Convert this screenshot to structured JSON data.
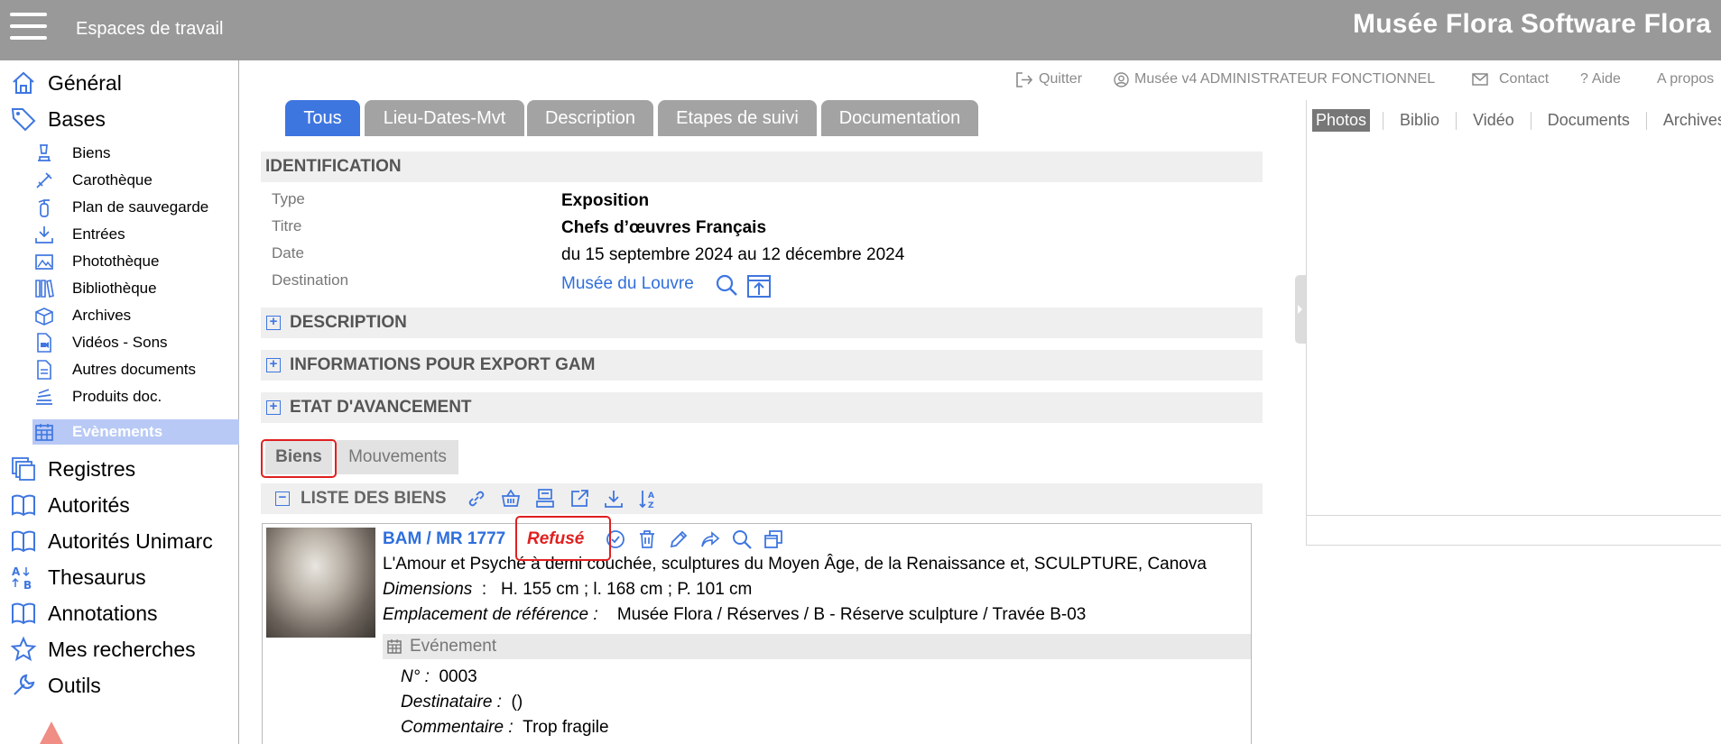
{
  "topbar": {
    "workspaces": "Espaces de travail",
    "app_title": "Musée Flora Software Flora"
  },
  "sidebar": {
    "top_items": [
      {
        "label": "Général",
        "icon": "home-icon"
      },
      {
        "label": "Bases",
        "icon": "tag-icon"
      }
    ],
    "sub_items": [
      {
        "label": "Biens",
        "icon": "object-icon"
      },
      {
        "label": "Carothèque",
        "icon": "pen-icon"
      },
      {
        "label": "Plan de sauvegarde",
        "icon": "extinguisher-icon"
      },
      {
        "label": "Entrées",
        "icon": "download-tray-icon"
      },
      {
        "label": "Photothèque",
        "icon": "image-icon"
      },
      {
        "label": "Bibliothèque",
        "icon": "books-icon"
      },
      {
        "label": "Archives",
        "icon": "box-icon"
      },
      {
        "label": "Vidéos - Sons",
        "icon": "video-file-icon"
      },
      {
        "label": "Autres documents",
        "icon": "document-icon"
      },
      {
        "label": "Produits doc.",
        "icon": "stack-icon"
      },
      {
        "label": "Evènements",
        "icon": "calendar-icon"
      }
    ],
    "bottom_items": [
      {
        "label": "Registres",
        "icon": "registers-icon"
      },
      {
        "label": "Autorités",
        "icon": "book-icon"
      },
      {
        "label": "Autorités Unimarc",
        "icon": "book-icon"
      },
      {
        "label": "Thesaurus",
        "icon": "az-icon"
      },
      {
        "label": "Annotations",
        "icon": "book-icon"
      },
      {
        "label": "Mes recherches",
        "icon": "star-icon"
      },
      {
        "label": "Outils",
        "icon": "wrench-icon"
      }
    ]
  },
  "header_links": {
    "quit": "Quitter",
    "user": "Musée v4 ADMINISTRATEUR FONCTIONNEL",
    "contact": "Contact",
    "help": "Aide",
    "about": "A propos"
  },
  "tabs": [
    "Tous",
    "Lieu-Dates-Mvt",
    "Description",
    "Etapes de suivi",
    "Documentation"
  ],
  "identification": {
    "title": "IDENTIFICATION",
    "fields": [
      {
        "label": "Type",
        "value": "Exposition"
      },
      {
        "label": "Titre",
        "value": "Chefs d’œuvres Français"
      },
      {
        "label": "Date",
        "value": "du 15 septembre 2024 au 12 décembre 2024"
      },
      {
        "label": "Destination",
        "value": "Musée du Louvre"
      }
    ]
  },
  "sections": {
    "description": "DESCRIPTION",
    "export": "INFORMATIONS POUR EXPORT GAM",
    "progress": "ETAT D'AVANCEMENT"
  },
  "subtabs": [
    "Biens",
    "Mouvements"
  ],
  "list": {
    "title": "LISTE DES BIENS",
    "item": {
      "ref": "BAM / MR 1777",
      "status": "Refusé",
      "description": "L'Amour et Psyché à demi couchée, sculptures du Moyen Âge, de la Renaissance et, SCULPTURE, Canova",
      "dimensions_label": "Dimensions",
      "dimensions_value": "H. 155 cm ; l. 168 cm ; P. 101 cm",
      "location_label": "Emplacement de référence :",
      "location_value": "Musée Flora / Réserves / B - Réserve sculpture / Travée B-03",
      "event_title": "Evénement",
      "number_label": "N° :",
      "number_value": "0003",
      "recipient_label": "Destinataire :",
      "recipient_value": "()",
      "comment_label": "Commentaire :",
      "comment_value": "Trop fragile"
    }
  },
  "right_panel": {
    "tabs": [
      "Photos",
      "Biblio",
      "Vidéo",
      "Documents",
      "Archives"
    ]
  },
  "colors": {
    "topbar": "#999999",
    "accent_blue": "#3e76e0",
    "status_red": "#e02020",
    "active_sidebar": "#b8c9f5"
  }
}
